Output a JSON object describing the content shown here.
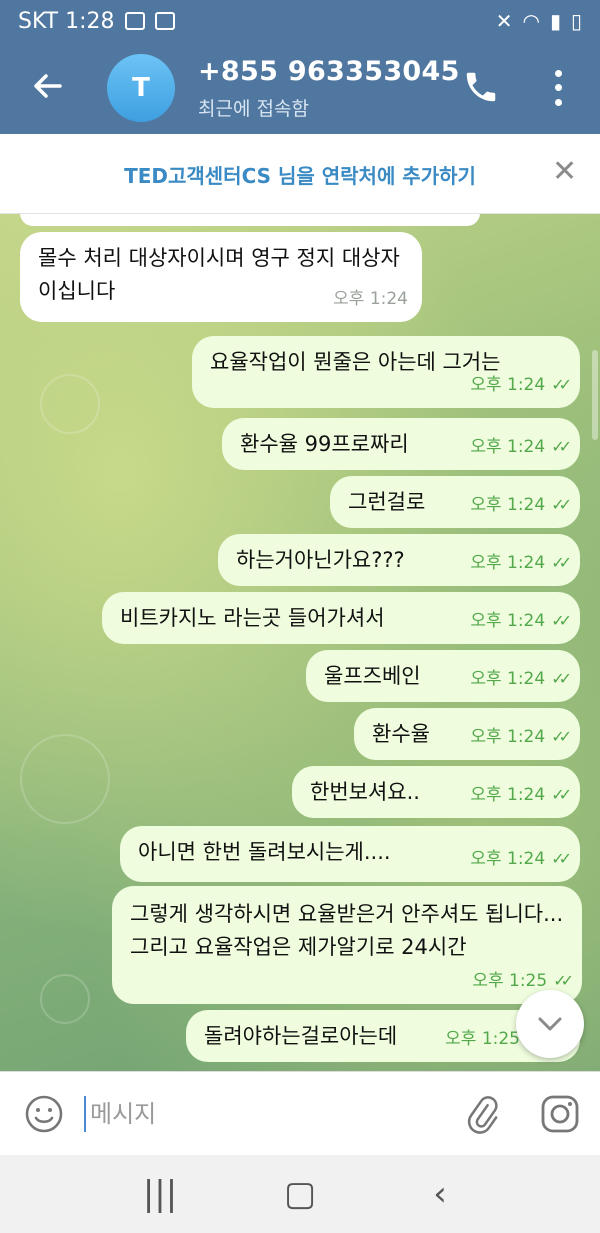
{
  "status": {
    "carrier_time": "SKT 1:28"
  },
  "header": {
    "avatar_letter": "T",
    "title": "+855 963353045",
    "subtitle": "최근에 접속함"
  },
  "add_contact": {
    "text": "TED고객센터CS 님을 연락처에 추가하기"
  },
  "messages": [
    {
      "dir": "in",
      "text": "몰수 처리 대상자이시며 영구 정지 대상자이십니다",
      "time": "오후 1:24"
    },
    {
      "dir": "out",
      "text": "요율작업이 뭔줄은 아는데 그거는",
      "time": "오후 1:24"
    },
    {
      "dir": "out",
      "text": "환수율 99프로짜리",
      "time": "오후 1:24"
    },
    {
      "dir": "out",
      "text": "그런걸로",
      "time": "오후 1:24"
    },
    {
      "dir": "out",
      "text": "하는거아닌가요???",
      "time": "오후 1:24"
    },
    {
      "dir": "out",
      "text": "비트카지노 라는곳 들어가셔서",
      "time": "오후 1:24"
    },
    {
      "dir": "out",
      "text": "울프즈베인",
      "time": "오후 1:24"
    },
    {
      "dir": "out",
      "text": "환수율",
      "time": "오후 1:24"
    },
    {
      "dir": "out",
      "text": "한번보셔요..",
      "time": "오후 1:24"
    },
    {
      "dir": "out",
      "text": "아니면 한번 돌려보시는게....",
      "time": "오후 1:24"
    },
    {
      "dir": "out",
      "text": "그렇게 생각하시면 요율받은거 안주셔도 됩니다... 그리고 요율작업은 제가알기로 24시간",
      "time": "오후 1:25"
    },
    {
      "dir": "out",
      "text": "돌려야하는걸로아는데",
      "time": "오후 1:25"
    }
  ],
  "input": {
    "placeholder": "메시지"
  },
  "icons": {
    "back": "back-arrow-icon",
    "call": "phone-icon",
    "menu": "more-vert-icon",
    "close": "close-icon",
    "emoji": "emoji-icon",
    "attach": "paperclip-icon",
    "camera": "instagram-camera-icon",
    "scroll_down": "chevron-down-icon",
    "nav_recent": "recents-icon",
    "nav_home": "home-icon",
    "nav_back": "nav-back-icon"
  },
  "colors": {
    "header": "#5077a0",
    "out_bubble": "#effdde",
    "accent": "#3a8ac4",
    "check": "#52a84a"
  }
}
